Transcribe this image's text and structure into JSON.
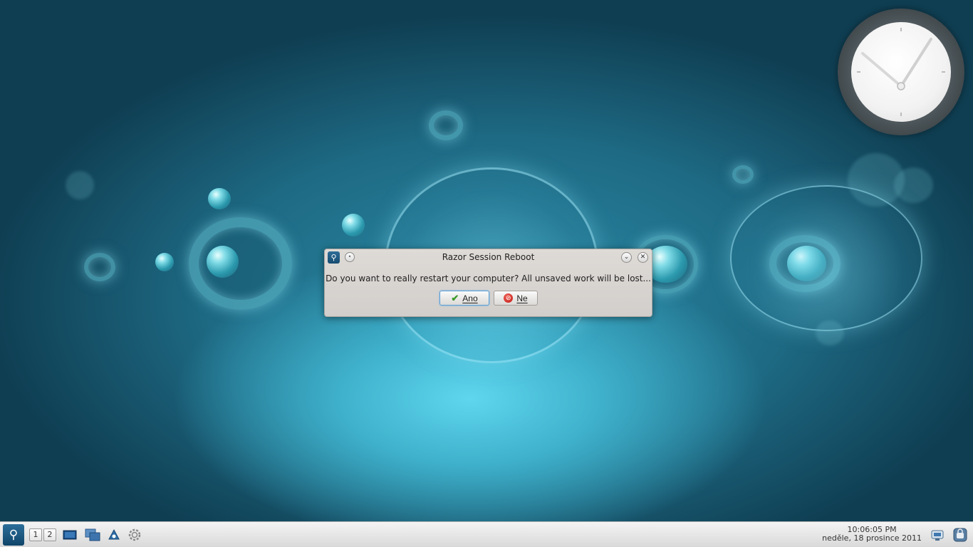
{
  "dialog": {
    "title": "Razor Session Reboot",
    "message": "Do you want to really restart your computer? All unsaved work will be lost...",
    "yes_label": "Ano",
    "no_label": "Ne"
  },
  "taskbar": {
    "desktops": [
      "1",
      "2"
    ],
    "time": "10:06:05 PM",
    "date": "neděle, 18 prosince 2011"
  },
  "colors": {
    "taskbar_bg": "#e6e6e6",
    "accent": "#1a5b86",
    "dialog_bg": "#d6d2cf"
  },
  "icons": [
    "razor-app-icon",
    "show-desktop-icon",
    "window-switcher-icon",
    "file-manager-icon",
    "settings-icon",
    "network-icon",
    "lock-screen-icon"
  ]
}
